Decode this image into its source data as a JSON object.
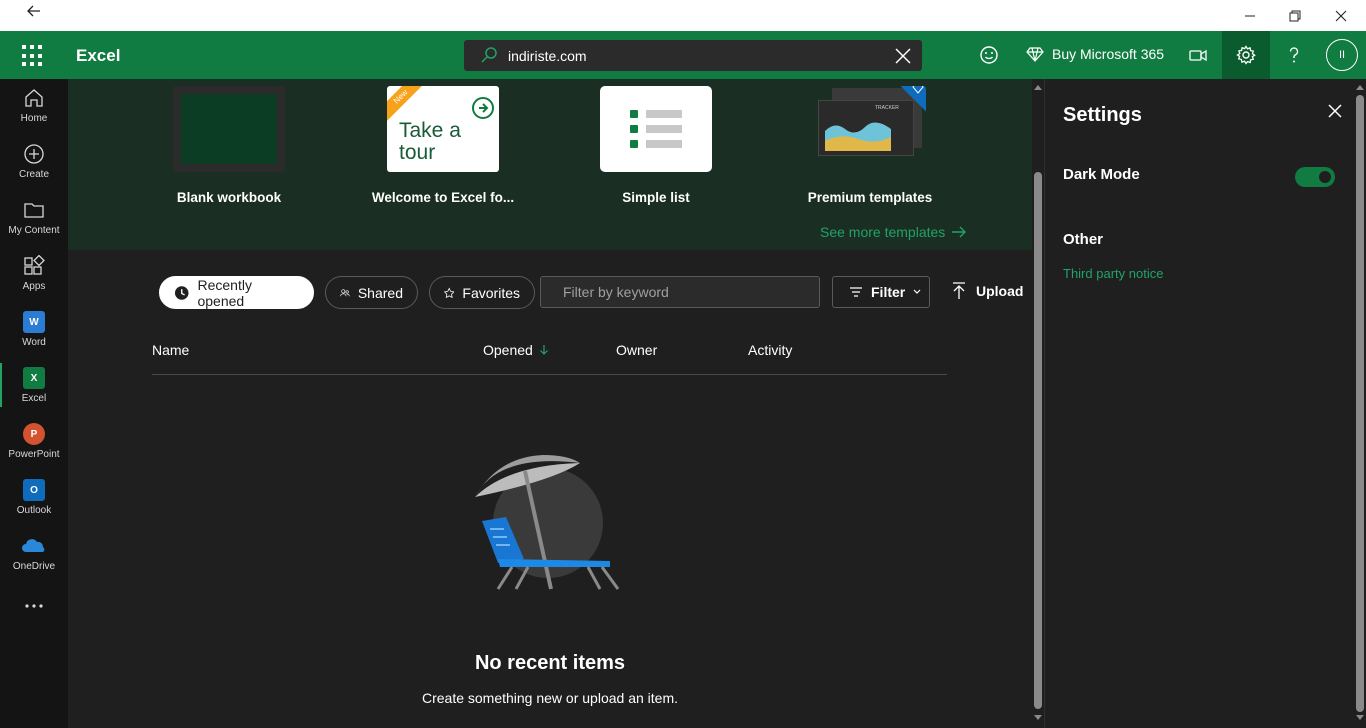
{
  "window": {
    "back_icon": "arrow-left-icon",
    "controls": [
      "minimize-icon",
      "restore-icon",
      "close-icon"
    ]
  },
  "header": {
    "app_name": "Excel",
    "search_value": "indiriste.com",
    "buy_label": "Buy Microsoft 365",
    "avatar_initials": "II",
    "accent_color": "#107c41"
  },
  "rail": {
    "items": [
      {
        "label": "Home"
      },
      {
        "label": "Create"
      },
      {
        "label": "My Content"
      },
      {
        "label": "Apps"
      },
      {
        "label": "Word"
      },
      {
        "label": "Excel"
      },
      {
        "label": "PowerPoint"
      },
      {
        "label": "Outlook"
      },
      {
        "label": "OneDrive"
      }
    ]
  },
  "templates": {
    "items": [
      {
        "label": "Blank workbook"
      },
      {
        "label": "Welcome to Excel fo...",
        "badge": "New",
        "thumb_text": "Take a tour"
      },
      {
        "label": "Simple list"
      },
      {
        "label": "Premium templates",
        "thumb_text": "TRACKER"
      }
    ],
    "see_more": "See more templates"
  },
  "files": {
    "tabs": [
      {
        "label": "Recently opened"
      },
      {
        "label": "Shared"
      },
      {
        "label": "Favorites"
      }
    ],
    "filter_placeholder": "Filter by keyword",
    "filter_label": "Filter",
    "upload_label": "Upload",
    "columns": [
      "Name",
      "Opened",
      "Owner",
      "Activity"
    ],
    "empty_title": "No recent items",
    "empty_subtitle": "Create something new or upload an item."
  },
  "settings": {
    "title": "Settings",
    "dark_mode_label": "Dark Mode",
    "dark_mode_on": true,
    "other_label": "Other",
    "third_party_link": "Third party notice"
  }
}
